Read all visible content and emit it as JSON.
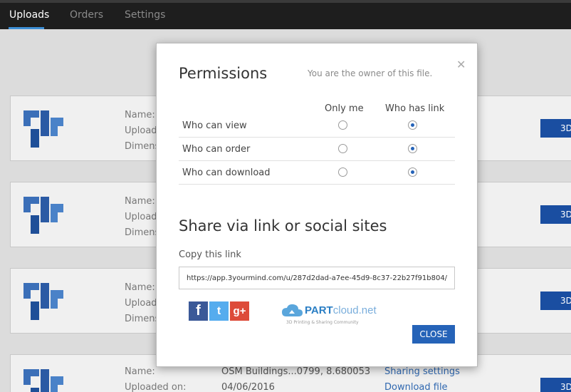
{
  "nav": {
    "tabs": [
      {
        "label": "Uploads",
        "active": true
      },
      {
        "label": "Orders",
        "active": false
      },
      {
        "label": "Settings",
        "active": false
      }
    ]
  },
  "cards": {
    "name_label": "Name:",
    "upload_label_short": "Upload",
    "dimens_label_short": "Dimens",
    "btn3d_label": "3D",
    "bottom": {
      "name_label": "Name:",
      "uploaded_label": "Uploaded on:",
      "name_value": "OSM Buildings...0799, 8.680053",
      "uploaded_value": "04/06/2016",
      "sharing_link": "Sharing settings",
      "download_link": "Download file"
    }
  },
  "modal": {
    "title": "Permissions",
    "owner_note": "You are the owner of this file.",
    "columns": [
      "Only me",
      "Who has link"
    ],
    "rows": [
      {
        "label": "Who can view",
        "only_me": false,
        "who_has_link": true
      },
      {
        "label": "Who can order",
        "only_me": false,
        "who_has_link": true
      },
      {
        "label": "Who can download",
        "only_me": false,
        "who_has_link": true
      }
    ],
    "share_title": "Share via link or social sites",
    "copy_label": "Copy this link",
    "link_value": "https://app.3yourmind.com/u/287d2dad-a7ee-45d9-8c37-22b27f91b804/",
    "social": {
      "facebook": "f",
      "twitter": "t",
      "google": "g+"
    },
    "partcloud_name_a": "PART",
    "partcloud_name_b": "cloud.net",
    "partcloud_tagline": "3D Printing & Sharing Community",
    "close_label": "CLOSE"
  },
  "colors": {
    "accent": "#2563b8",
    "nav_bg": "#1e1e1e",
    "brand_blue": "#1a4ea1"
  }
}
